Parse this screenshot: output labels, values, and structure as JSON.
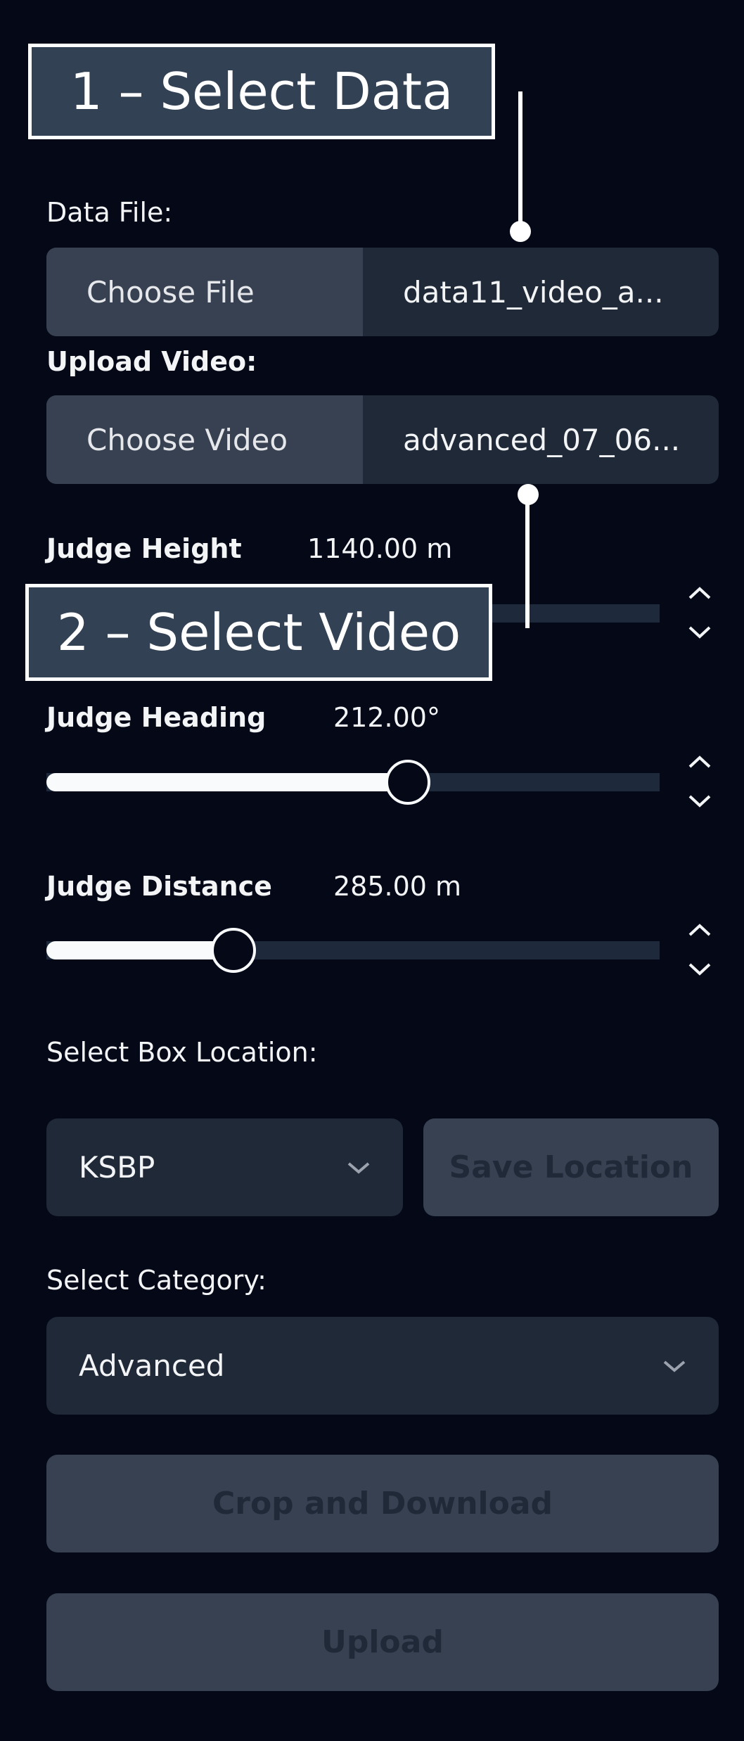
{
  "annotations": {
    "step1": "1 – Select Data",
    "step2": "2 – Select Video"
  },
  "data_file": {
    "label": "Data File:",
    "button": "Choose File",
    "filename": "data11_video_a..."
  },
  "upload_video": {
    "label": "Upload Video:",
    "button": "Choose Video",
    "filename": "advanced_07_06..."
  },
  "sliders": [
    {
      "label": "Judge Height",
      "value": "1140.00 m",
      "fill_fraction": null
    },
    {
      "label": "Judge Heading",
      "value": "212.00°",
      "fill_fraction": 0.59
    },
    {
      "label": "Judge Distance",
      "value": "285.00 m",
      "fill_fraction": 0.305
    }
  ],
  "box_location": {
    "label": "Select Box Location:",
    "selected": "KSBP",
    "save_button": "Save Location"
  },
  "category": {
    "label": "Select Category:",
    "selected": "Advanced"
  },
  "actions": {
    "crop_download": "Crop and Download",
    "upload": "Upload"
  },
  "colors": {
    "background": "#040817",
    "input_bg": "#1f2937",
    "button_bg": "#374151",
    "callout_bg": "#334155"
  }
}
